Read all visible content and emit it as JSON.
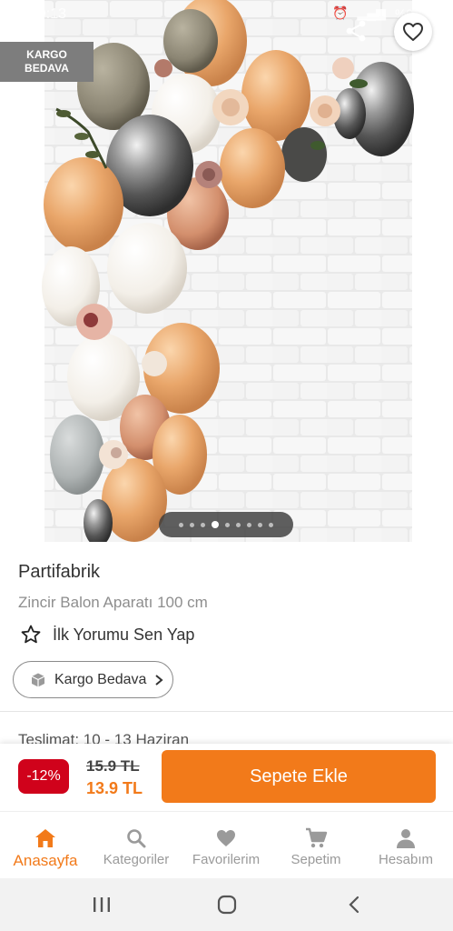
{
  "status_bar": {
    "time": "19:13",
    "battery": "%92"
  },
  "hero": {
    "badge_line1": "KARGO",
    "badge_line2": "BEDAVA",
    "image_count": 9,
    "active_image_index": 3
  },
  "product": {
    "brand": "Partifabrik",
    "name": "Zincir Balon Aparatı 100 cm",
    "review_link": "İlk Yorumu Sen Yap",
    "cargo_chip": "Kargo Bedava",
    "delivery": "Teslimat: 10 - 13 Haziran"
  },
  "price": {
    "discount": "-12%",
    "old_price": "15.9 TL",
    "new_price": "13.9 TL",
    "add_to_cart": "Sepete Ekle"
  },
  "bottom_nav": [
    {
      "label": "Anasayfa",
      "icon": "home-icon",
      "active": true
    },
    {
      "label": "Kategoriler",
      "icon": "search-icon",
      "active": false
    },
    {
      "label": "Favorilerim",
      "icon": "heart-icon",
      "active": false
    },
    {
      "label": "Sepetim",
      "icon": "cart-icon",
      "active": false
    },
    {
      "label": "Hesabım",
      "icon": "user-icon",
      "active": false
    }
  ],
  "colors": {
    "accent": "#f27a1a",
    "discount_badge": "#d0021b",
    "kargo_badge": "#7d7d7d"
  }
}
